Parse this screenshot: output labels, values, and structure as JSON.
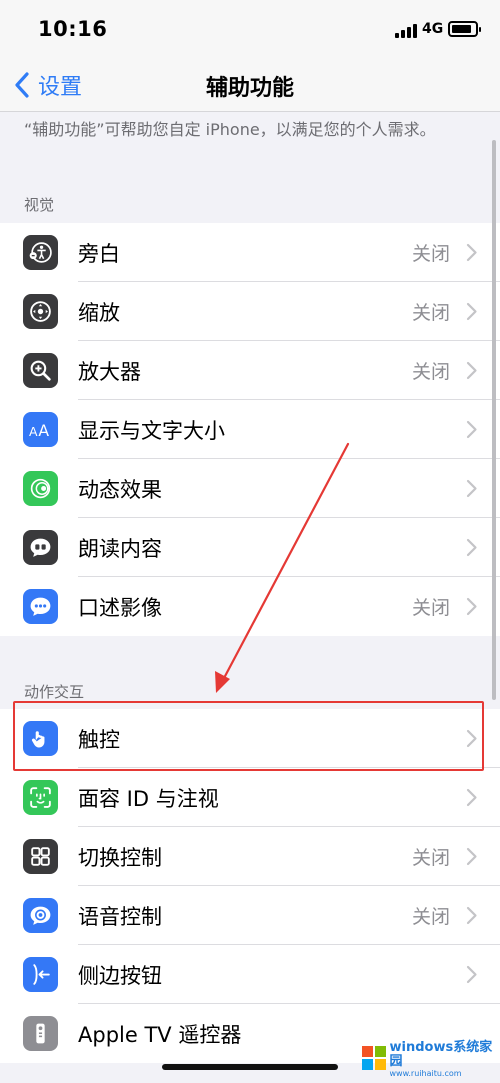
{
  "status_bar": {
    "time": "10:16",
    "network": "4G",
    "battery_level": 0.85
  },
  "nav": {
    "back_label": "设置",
    "title": "辅助功能"
  },
  "description": "“辅助功能”可帮助您自定 iPhone，以满足您的个人需求。",
  "sections": [
    {
      "header": "视觉",
      "rows": [
        {
          "label": "旁白",
          "value": "关闭",
          "icon": "voiceover-icon",
          "icon_color": "#3a3a3c"
        },
        {
          "label": "缩放",
          "value": "关闭",
          "icon": "zoom-icon",
          "icon_color": "#3a3a3c"
        },
        {
          "label": "放大器",
          "value": "关闭",
          "icon": "magnifier-icon",
          "icon_color": "#3a3a3c"
        },
        {
          "label": "显示与文字大小",
          "value": "",
          "icon": "text-size-icon",
          "icon_color": "#3478f6"
        },
        {
          "label": "动态效果",
          "value": "",
          "icon": "motion-icon",
          "icon_color": "#34c759"
        },
        {
          "label": "朗读内容",
          "value": "",
          "icon": "spoken-content-icon",
          "icon_color": "#3a3a3c"
        },
        {
          "label": "口述影像",
          "value": "关闭",
          "icon": "audio-description-icon",
          "icon_color": "#3478f6"
        }
      ]
    },
    {
      "header": "动作交互",
      "rows": [
        {
          "label": "触控",
          "value": "",
          "icon": "touch-icon",
          "icon_color": "#3478f6"
        },
        {
          "label": "面容 ID 与注视",
          "value": "",
          "icon": "face-id-icon",
          "icon_color": "#34c759"
        },
        {
          "label": "切换控制",
          "value": "关闭",
          "icon": "switch-control-icon",
          "icon_color": "#3a3a3c"
        },
        {
          "label": "语音控制",
          "value": "关闭",
          "icon": "voice-control-icon",
          "icon_color": "#3478f6"
        },
        {
          "label": "侧边按钮",
          "value": "",
          "icon": "side-button-icon",
          "icon_color": "#3478f6"
        },
        {
          "label": "Apple TV 遥控器",
          "value": "",
          "icon": "apple-tv-remote-icon",
          "icon_color": "#8e8e93"
        }
      ]
    }
  ],
  "annotation_color": "#e53935",
  "watermark": {
    "text": "windows系统家园",
    "sub": "www.ruihaitu.com"
  }
}
